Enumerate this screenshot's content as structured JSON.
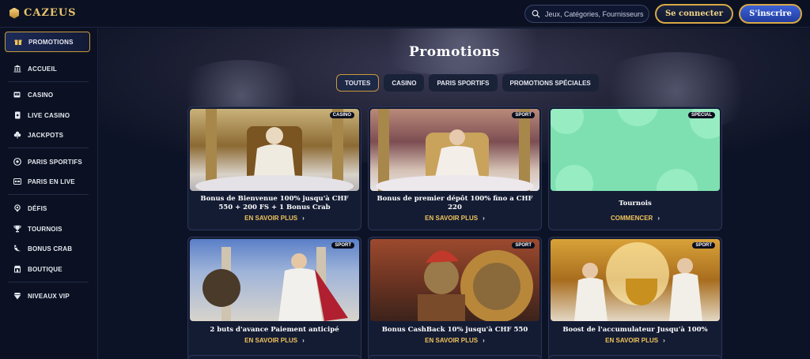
{
  "header": {
    "logo_text": "CAZEUS",
    "search_placeholder": "Jeux, Catégories, Fournisseurs",
    "login_label": "Se connecter",
    "register_label": "S'inscrire"
  },
  "sidebar": {
    "items": [
      {
        "label": "PROMOTIONS",
        "icon": "gift-icon"
      },
      {
        "label": "ACCUEIL",
        "icon": "temple-icon"
      },
      {
        "label": "CASINO",
        "icon": "slot-icon"
      },
      {
        "label": "LIVE CASINO",
        "icon": "card-icon"
      },
      {
        "label": "JACKPOTS",
        "icon": "clover-icon"
      },
      {
        "label": "PARIS SPORTIFS",
        "icon": "ball-icon"
      },
      {
        "label": "PARIS EN LIVE",
        "icon": "live-icon"
      },
      {
        "label": "DÉFIS",
        "icon": "medal-icon"
      },
      {
        "label": "TOURNOIS",
        "icon": "trophy-icon"
      },
      {
        "label": "BONUS CRAB",
        "icon": "crab-icon"
      },
      {
        "label": "BOUTIQUE",
        "icon": "shop-icon"
      },
      {
        "label": "NIVEAUX VIP",
        "icon": "diamond-icon"
      }
    ]
  },
  "main": {
    "title": "Promotions",
    "tabs": [
      "TOUTES",
      "CASINO",
      "PARIS SPORTIFS",
      "PROMOTIONS SPÉCIALES"
    ],
    "cards": [
      {
        "badge": "CASINO",
        "title": "Bonus de Bienvenue 100% jusqu'à CHF 550 + 200 FS + 1 Bonus Crab",
        "link": "EN SAVOIR PLUS"
      },
      {
        "badge": "SPORT",
        "title": "Bonus de premier dépôt 100% fino a CHF 220",
        "link": "EN SAVOIR PLUS"
      },
      {
        "badge": "SPÉCIAL",
        "title": "Tournois",
        "link": "COMMENCER"
      },
      {
        "badge": "SPORT",
        "title": "2 buts d'avance Paiement anticipé",
        "link": "EN SAVOIR PLUS"
      },
      {
        "badge": "SPORT",
        "title": "Bonus CashBack 10% jusqu'à CHF 550",
        "link": "EN SAVOIR PLUS"
      },
      {
        "badge": "SPORT",
        "title": "Boost de l'accumulateur Jusqu'à 100%",
        "link": "EN SAVOIR PLUS"
      }
    ]
  },
  "colors": {
    "accent_gold": "#d8a947",
    "link_gold": "#f0c35a",
    "background": "#0d1326",
    "register_blue": "#2f50c0",
    "tournois_green": "#7ee0b0"
  }
}
